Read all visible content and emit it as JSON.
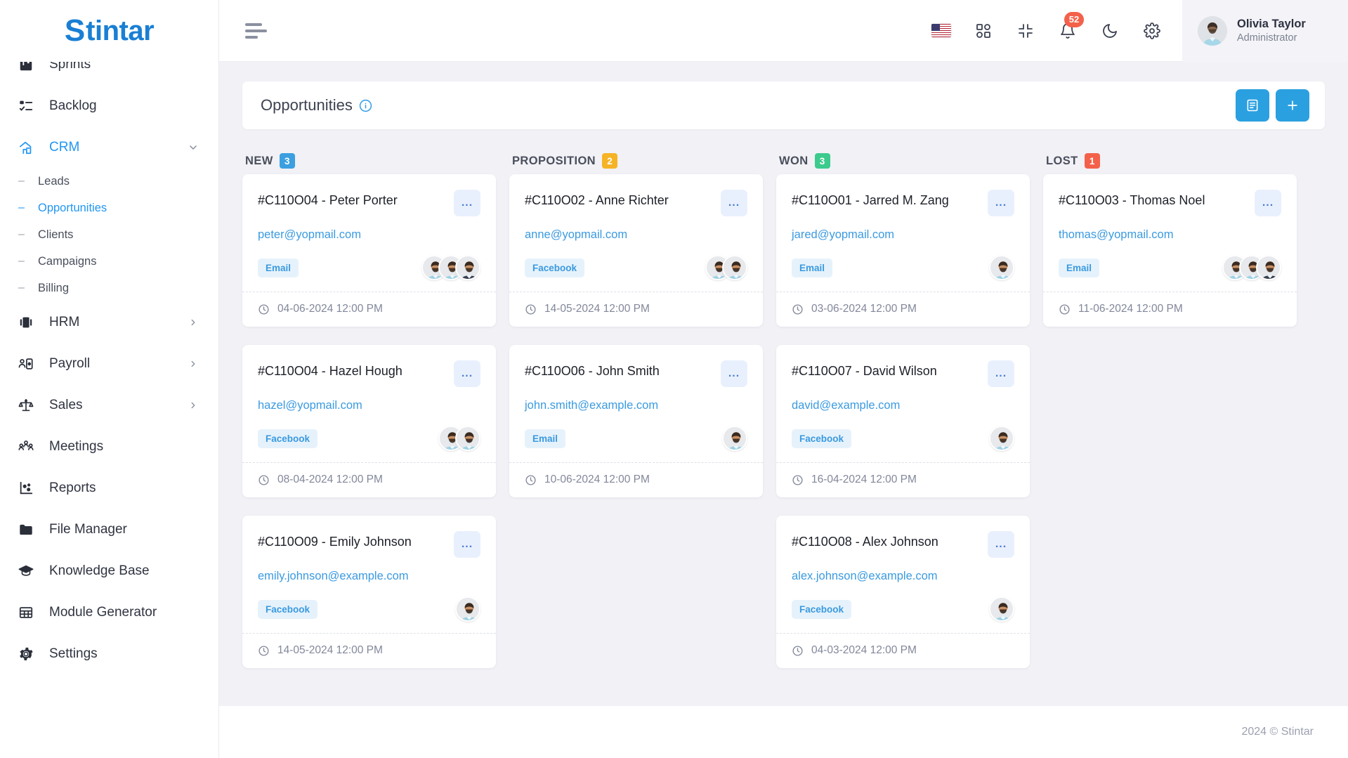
{
  "brand": {
    "mark": "S",
    "name": "tintar"
  },
  "sidebar": {
    "items": [
      {
        "label": "Sprints",
        "icon": "board-icon",
        "active": false,
        "expandable": false
      },
      {
        "label": "Backlog",
        "icon": "checklist-icon",
        "active": false,
        "expandable": false
      },
      {
        "label": "CRM",
        "icon": "crm-icon",
        "active": true,
        "expandable": true,
        "expanded": true
      },
      {
        "label": "HRM",
        "icon": "hrm-icon",
        "active": false,
        "expandable": true
      },
      {
        "label": "Payroll",
        "icon": "payroll-icon",
        "active": false,
        "expandable": true
      },
      {
        "label": "Sales",
        "icon": "sales-scale-icon",
        "active": false,
        "expandable": true
      },
      {
        "label": "Meetings",
        "icon": "meetings-icon",
        "active": false,
        "expandable": false
      },
      {
        "label": "Reports",
        "icon": "reports-icon",
        "active": false,
        "expandable": false
      },
      {
        "label": "File Manager",
        "icon": "folder-icon",
        "active": false,
        "expandable": false
      },
      {
        "label": "Knowledge Base",
        "icon": "graduation-cap-icon",
        "active": false,
        "expandable": false
      },
      {
        "label": "Module Generator",
        "icon": "grid-table-icon",
        "active": false,
        "expandable": false
      },
      {
        "label": "Settings",
        "icon": "gear-icon",
        "active": false,
        "expandable": false
      }
    ],
    "crm_children": [
      {
        "label": "Leads",
        "active": false
      },
      {
        "label": "Opportunities",
        "active": true
      },
      {
        "label": "Clients",
        "active": false
      },
      {
        "label": "Campaigns",
        "active": false
      },
      {
        "label": "Billing",
        "active": false
      }
    ]
  },
  "topbar": {
    "menu_toggle": "hamburger-icon",
    "icons": [
      {
        "name": "language-flag-us-icon"
      },
      {
        "name": "apps-grid-icon"
      },
      {
        "name": "fullscreen-collapse-icon"
      },
      {
        "name": "notification-bell-icon",
        "badge": "52"
      },
      {
        "name": "dark-mode-moon-icon"
      },
      {
        "name": "settings-gear-icon"
      }
    ],
    "profile": {
      "name": "Olivia Taylor",
      "role": "Administrator"
    }
  },
  "page": {
    "title": "Opportunities",
    "info_icon": "info-circle-icon",
    "buttons": [
      {
        "name": "list-view-button",
        "icon": "list-view-icon"
      },
      {
        "name": "add-opportunity-button",
        "icon": "plus-icon",
        "label": "+"
      }
    ]
  },
  "board": {
    "columns": [
      {
        "name": "NEW",
        "count": "3",
        "color": "#3c9fe0",
        "cards": [
          {
            "title": "#C110O04 - Peter Porter",
            "email": "peter@yopmail.com",
            "tag": "Email",
            "avatars": 3,
            "date": "04-06-2024 12:00 PM",
            "menu": "..."
          },
          {
            "title": "#C110O04 - Hazel Hough",
            "email": "hazel@yopmail.com",
            "tag": "Facebook",
            "avatars": 2,
            "date": "08-04-2024 12:00 PM",
            "menu": "..."
          },
          {
            "title": "#C110O09 - Emily Johnson",
            "email": "emily.johnson@example.com",
            "tag": "Facebook",
            "avatars": 1,
            "date": "14-05-2024 12:00 PM",
            "menu": "..."
          }
        ]
      },
      {
        "name": "PROPOSITION",
        "count": "2",
        "color": "#f5b325",
        "cards": [
          {
            "title": "#C110O02 - Anne Richter",
            "email": "anne@yopmail.com",
            "tag": "Facebook",
            "avatars": 2,
            "date": "14-05-2024 12:00 PM",
            "menu": "..."
          },
          {
            "title": "#C110O06 - John Smith",
            "email": "john.smith@example.com",
            "tag": "Email",
            "avatars": 1,
            "date": "10-06-2024 12:00 PM",
            "menu": "..."
          }
        ]
      },
      {
        "name": "WON",
        "count": "3",
        "color": "#3dcb8d",
        "cards": [
          {
            "title": "#C110O01 - Jarred M. Zang",
            "email": "jared@yopmail.com",
            "tag": "Email",
            "avatars": 1,
            "date": "03-06-2024 12:00 PM",
            "menu": "..."
          },
          {
            "title": "#C110O07 - David Wilson",
            "email": "david@example.com",
            "tag": "Facebook",
            "avatars": 1,
            "date": "16-04-2024 12:00 PM",
            "menu": "..."
          },
          {
            "title": "#C110O08 - Alex Johnson",
            "email": "alex.johnson@example.com",
            "tag": "Facebook",
            "avatars": 1,
            "date": "04-03-2024 12:00 PM",
            "menu": "..."
          }
        ]
      },
      {
        "name": "LOST",
        "count": "1",
        "color": "#f4614a",
        "cards": [
          {
            "title": "#C110O03 - Thomas Noel",
            "email": "thomas@yopmail.com",
            "tag": "Email",
            "avatars": 3,
            "date": "11-06-2024 12:00 PM",
            "menu": "..."
          }
        ]
      }
    ]
  },
  "footer": {
    "copyright": "2024 © Stintar"
  },
  "colors": {
    "accent": "#2ba0e0",
    "link": "#3a9ae0",
    "page_bg": "#f1f1f6",
    "badge_new": "#3c9fe0",
    "badge_proposition": "#f5b325",
    "badge_won": "#3dcb8d",
    "badge_lost": "#f4614a"
  }
}
